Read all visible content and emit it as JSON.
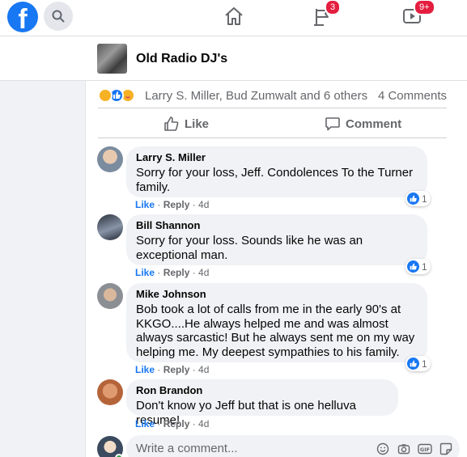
{
  "nav": {
    "logo_letter": "f",
    "groups_badge": "3",
    "watch_badge": "9+"
  },
  "page": {
    "name": "Old Radio DJ's"
  },
  "post": {
    "reaction_names": "Larry S. Miller, Bud Zumwalt and 6 others",
    "comments_count": "4 Comments",
    "like_label": "Like",
    "comment_label": "Comment",
    "reaction_icons": [
      "sad-face",
      "like-thumb",
      "care-hug"
    ]
  },
  "comments": [
    {
      "author": "Larry S. Miller",
      "text": "Sorry for your loss, Jeff. Condolences To the Turner family.",
      "like": "Like",
      "reply": "Reply",
      "time": "4d",
      "reactions": "1"
    },
    {
      "author": "Bill Shannon",
      "text": "Sorry for your loss. Sounds like he was an exceptional man.",
      "like": "Like",
      "reply": "Reply",
      "time": "4d",
      "reactions": "1"
    },
    {
      "author": "Mike Johnson",
      "text": "Bob took a lot of calls from me in the early 90's at KKGO....He always helped me and was almost always sarcastic! But he always sent me on my way helping me. My deepest sympathies to his family.",
      "like": "Like",
      "reply": "Reply",
      "time": "4d",
      "reactions": "1"
    },
    {
      "author": "Ron Brandon",
      "text": "Don't know yo Jeff but that is one helluva resume!",
      "like": "Like",
      "reply": "Reply",
      "time": "4d"
    }
  ],
  "write_comment": {
    "placeholder": "Write a comment...",
    "icons": [
      "emoji-icon",
      "camera-icon",
      "gif-icon",
      "sticker-icon"
    ]
  },
  "colors": {
    "brand": "#1877f2",
    "badge": "#e41e3f",
    "online": "#31a24c"
  }
}
